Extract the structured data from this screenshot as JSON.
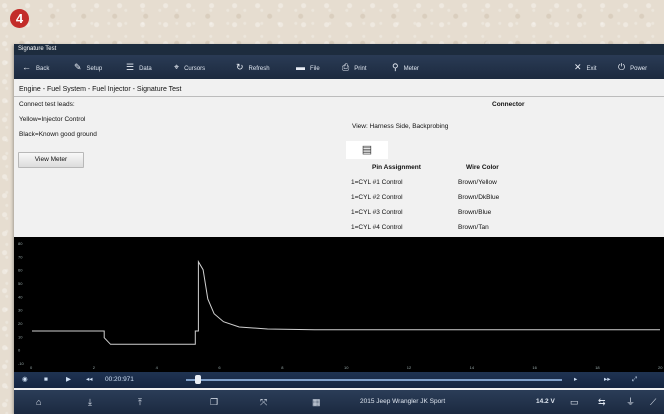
{
  "step_badge": "4",
  "window": {
    "title": "Signature Test"
  },
  "toolbar": {
    "back": "Back",
    "setup": "Setup",
    "data": "Data",
    "cursors": "Cursors",
    "refresh": "Refresh",
    "file": "File",
    "print": "Print",
    "meter": "Meter",
    "exit": "Exit",
    "power": "Power"
  },
  "breadcrumb": "Engine - Fuel System - Fuel Injector - Signature Test",
  "instructions": {
    "heading": "Connect test leads:",
    "line1": "Yellow=Injector Control",
    "line2": "Black=Known good ground",
    "view_meter_button": "View Meter"
  },
  "connector": {
    "title": "Connector",
    "view": "View: Harness Side, Backprobing",
    "headers": {
      "pin": "Pin Assignment",
      "wire": "Wire Color"
    },
    "rows": [
      {
        "pin": "1=CYL #1 Control",
        "wire": "Brown/Yellow"
      },
      {
        "pin": "1=CYL #2 Control",
        "wire": "Brown/DkBlue"
      },
      {
        "pin": "1=CYL #3 Control",
        "wire": "Brown/Blue"
      },
      {
        "pin": "1=CYL #4 Control",
        "wire": "Brown/Tan"
      }
    ]
  },
  "chart_data": {
    "type": "line",
    "x_ticks": [
      "0",
      "2",
      "4",
      "6",
      "8",
      "10",
      "12",
      "14",
      "16",
      "18",
      "20"
    ],
    "y_ticks": [
      "80",
      "70",
      "60",
      "50",
      "40",
      "30",
      "20",
      "10",
      "0",
      "-10"
    ],
    "ylim": [
      -10,
      80
    ],
    "xlim": [
      0,
      20
    ],
    "series": [
      {
        "color": "#d0d0d0",
        "points": [
          [
            0,
            14
          ],
          [
            2.3,
            14
          ],
          [
            2.3,
            9
          ],
          [
            2.5,
            4
          ],
          [
            5.2,
            4
          ],
          [
            5.2,
            14
          ],
          [
            5.3,
            14
          ],
          [
            5.3,
            66
          ],
          [
            5.45,
            60
          ],
          [
            5.6,
            38
          ],
          [
            5.8,
            27
          ],
          [
            6.1,
            21
          ],
          [
            6.6,
            17
          ],
          [
            7.5,
            15.5
          ],
          [
            9,
            15
          ],
          [
            20,
            15
          ]
        ]
      }
    ]
  },
  "playback": {
    "time": "00:20:971"
  },
  "status": {
    "vehicle": "2015 Jeep Wrangler JK Sport",
    "voltage": "14.2 V"
  },
  "colors": {
    "badge": "#c32d2a",
    "toolbar": "#1d2c3e",
    "trace": "#d0d0d0"
  }
}
